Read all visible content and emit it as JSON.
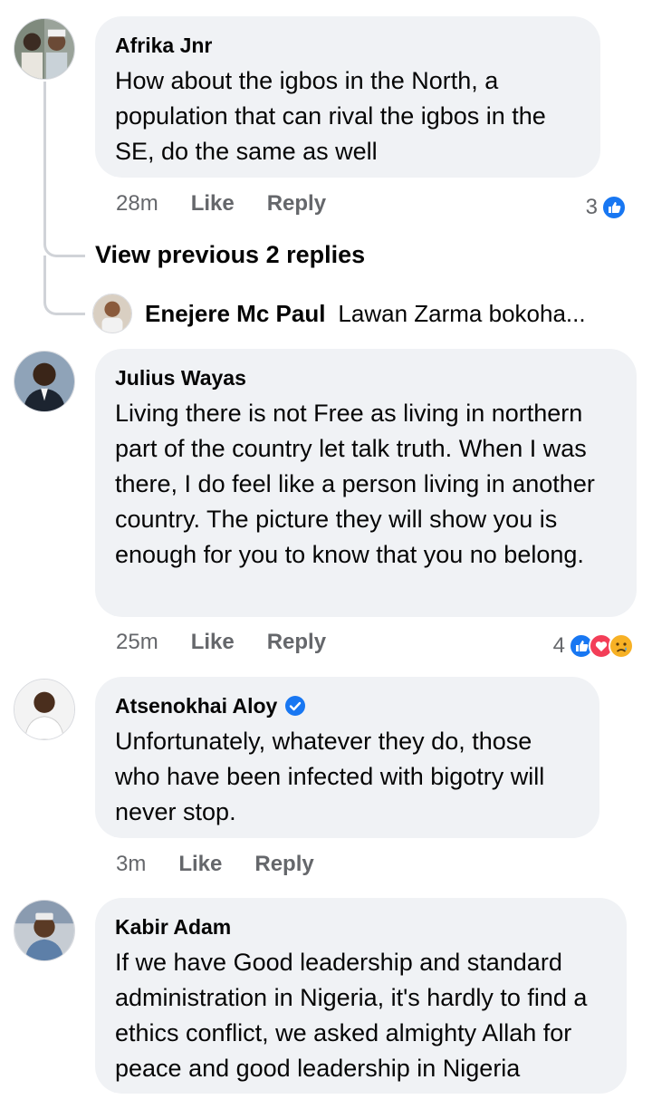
{
  "comments": [
    {
      "author": "Afrika Jnr",
      "text": "How about the igbos in the North, a population that can rival the igbos in the SE, do the same as well",
      "time": "28m",
      "like_label": "Like",
      "reply_label": "Reply",
      "reaction_count": "3",
      "reactions": [
        "like-icon"
      ]
    },
    {
      "author": "Julius Wayas",
      "text": "Living there is not Free as living in northern part of the country let talk truth. When I was there, I do feel like a person living in another country. The picture they will show you is enough for you to know that you no belong.",
      "time": "25m",
      "like_label": "Like",
      "reply_label": "Reply",
      "reaction_count": "4",
      "reactions": [
        "like-icon",
        "love-icon",
        "sad-icon"
      ]
    },
    {
      "author": "Atsenokhai Aloy",
      "verified": true,
      "text": "Unfortunately,  whatever they do, those who have been infected with bigotry will never stop.",
      "time": "3m",
      "like_label": "Like",
      "reply_label": "Reply"
    },
    {
      "author": "Kabir Adam",
      "text": "If we have Good leadership and standard administration in Nigeria, it's hardly to find a ethics conflict,  we asked almighty Allah for peace and good leadership in Nigeria"
    }
  ],
  "thread": {
    "view_previous": "View previous 2 replies",
    "reply_author": "Enejere Mc Paul",
    "reply_preview": "Lawan Zarma bokoha..."
  },
  "colors": {
    "bubble": "#f0f2f5",
    "meta": "#65676b",
    "like_blue": "#1877f2",
    "love_red": "#f33e58"
  }
}
